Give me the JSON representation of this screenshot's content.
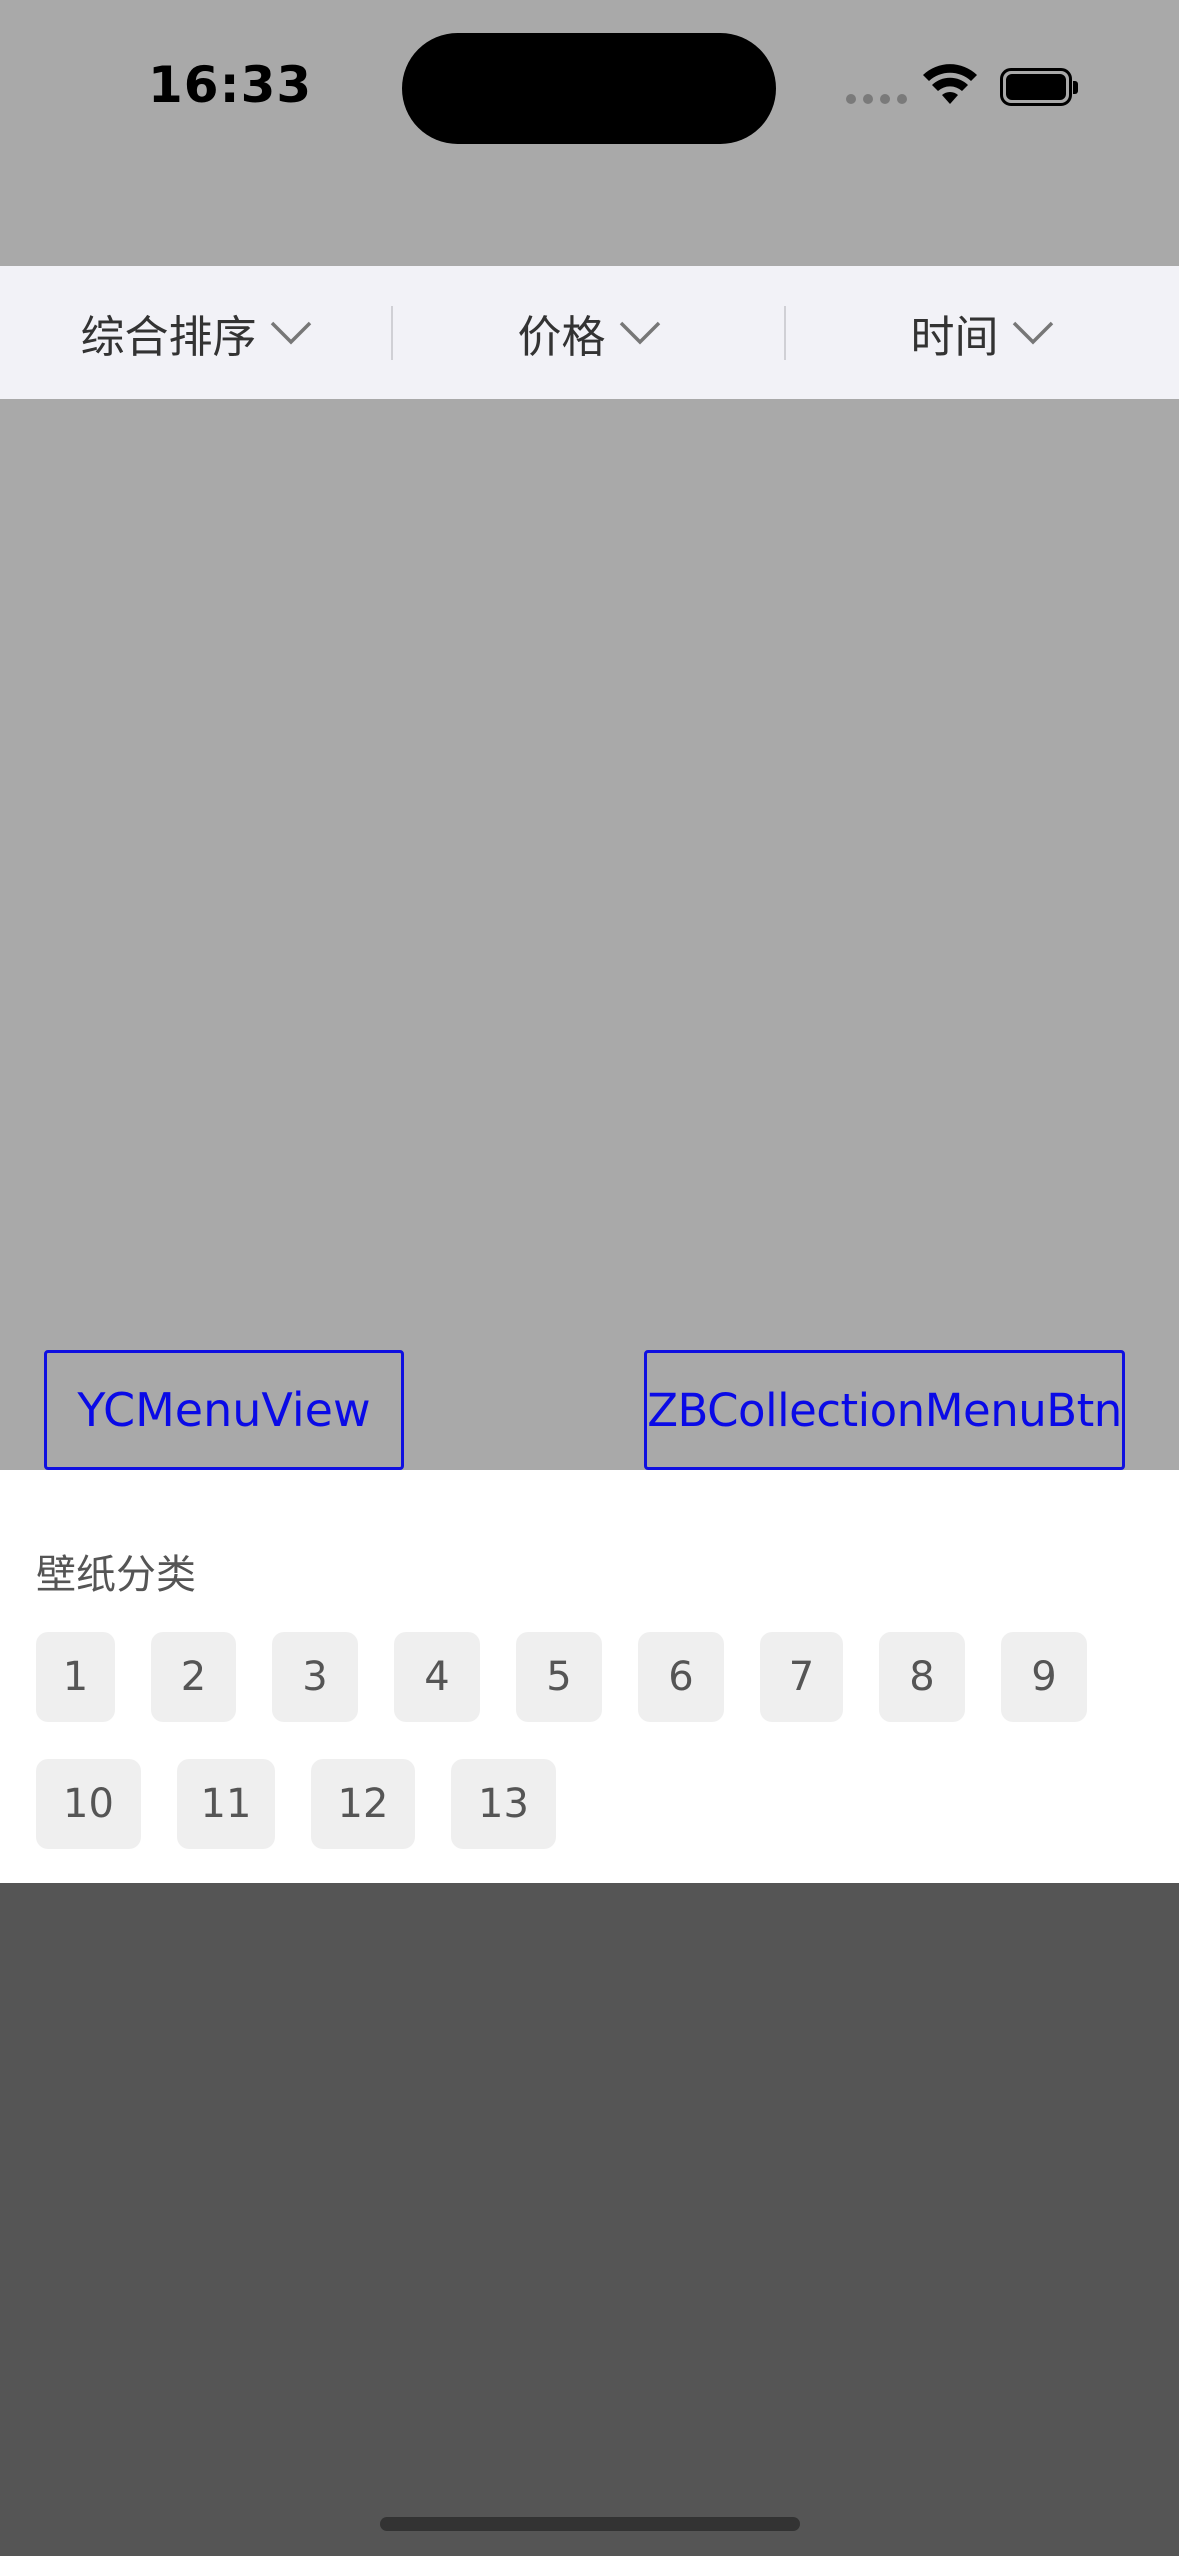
{
  "status_bar": {
    "time": "16:33"
  },
  "filter_bar": {
    "items": [
      {
        "label": "综合排序"
      },
      {
        "label": "价格"
      },
      {
        "label": "时间"
      }
    ]
  },
  "debug_buttons": {
    "menu_view": "YCMenuView",
    "collection_menu_btn": "ZBCollectionMenuBtn"
  },
  "category_panel": {
    "title": "壁纸分类",
    "chips": [
      "1",
      "2",
      "3",
      "4",
      "5",
      "6",
      "7",
      "8",
      "9",
      "10",
      "11",
      "12",
      "13"
    ]
  },
  "colors": {
    "accent_blue": "#0a0ae6",
    "filter_bar_bg": "#f2f2f7",
    "backdrop": "#a9a9a9",
    "dim_overlay": "#555555"
  },
  "icons": [
    "wifi-icon",
    "battery-icon",
    "chevron-down-icon"
  ]
}
